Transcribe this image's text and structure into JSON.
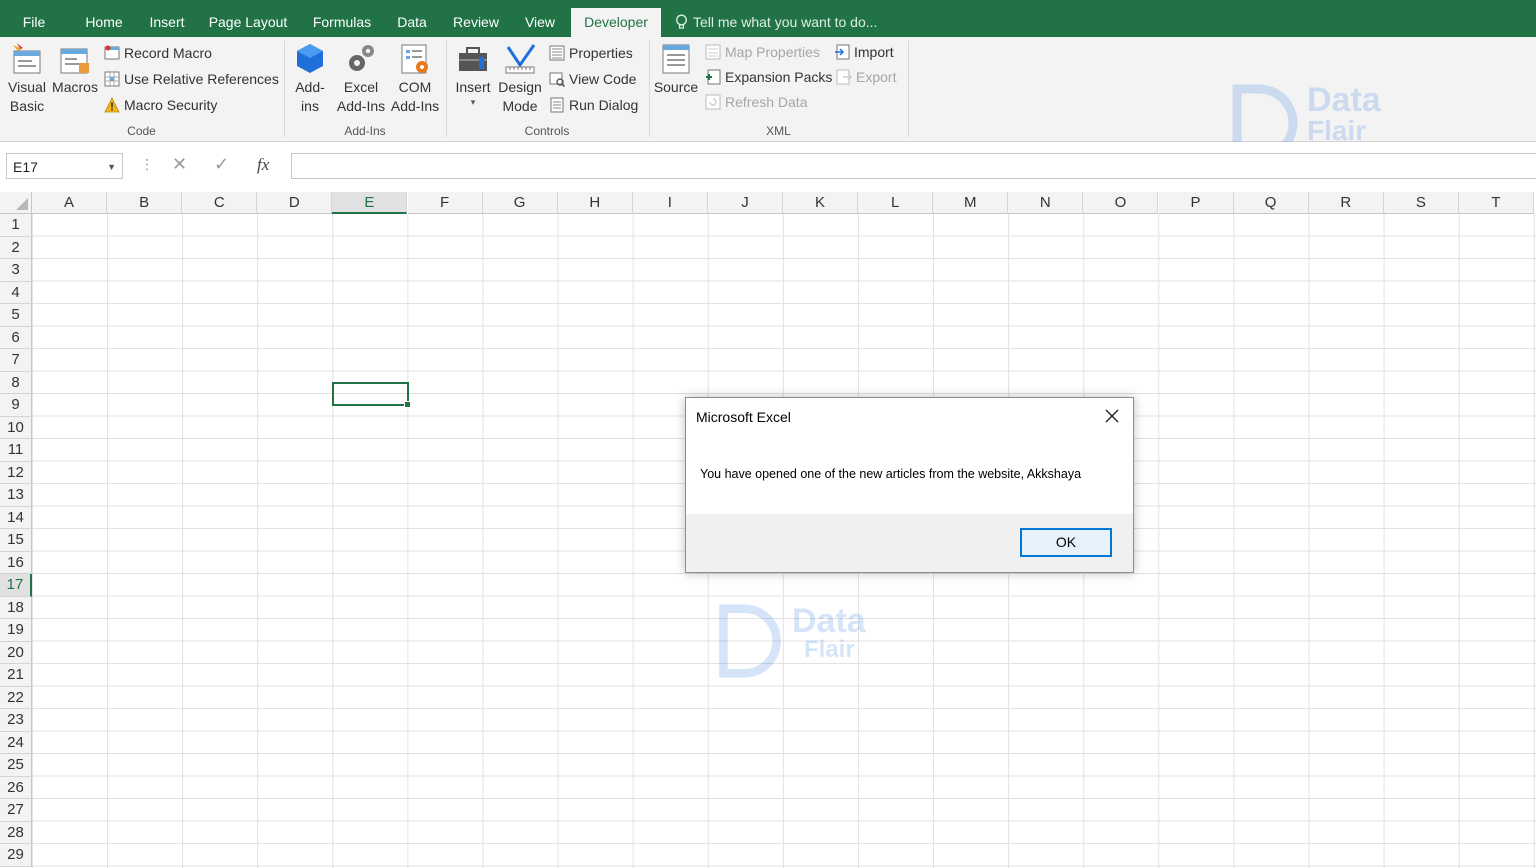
{
  "tabs": [
    "File",
    "Home",
    "Insert",
    "Page Layout",
    "Formulas",
    "Data",
    "Review",
    "View",
    "Developer"
  ],
  "active_tab": "Developer",
  "tell_me": "Tell me what you want to do...",
  "ribbon": {
    "code": {
      "label": "Code",
      "visual_basic": [
        "Visual",
        "Basic"
      ],
      "macros": "Macros",
      "record_macro": "Record Macro",
      "use_relative": "Use Relative References",
      "macro_security": "Macro Security"
    },
    "addins": {
      "label": "Add-Ins",
      "addins": [
        "Add-",
        "ins"
      ],
      "excel_addins": [
        "Excel",
        "Add-Ins"
      ],
      "com_addins": [
        "COM",
        "Add-Ins"
      ]
    },
    "controls": {
      "label": "Controls",
      "insert": "Insert",
      "design_mode": [
        "Design",
        "Mode"
      ],
      "properties": "Properties",
      "view_code": "View Code",
      "run_dialog": "Run Dialog"
    },
    "xml": {
      "label": "XML",
      "source": "Source",
      "map_properties": "Map Properties",
      "expansion_packs": "Expansion Packs",
      "refresh_data": "Refresh Data",
      "import": "Import",
      "export": "Export"
    }
  },
  "formula_bar": {
    "name_box": "E17",
    "fx": "fx",
    "value": ""
  },
  "columns": [
    "A",
    "B",
    "C",
    "D",
    "E",
    "F",
    "G",
    "H",
    "I",
    "J",
    "K",
    "L",
    "M",
    "N",
    "O",
    "P",
    "Q",
    "R",
    "S",
    "T"
  ],
  "rows": [
    "1",
    "2",
    "3",
    "4",
    "5",
    "6",
    "7",
    "8",
    "9",
    "10",
    "11",
    "12",
    "13",
    "14",
    "15",
    "16",
    "17",
    "18",
    "19",
    "20",
    "21",
    "22",
    "23",
    "24",
    "25",
    "26",
    "27",
    "28",
    "29"
  ],
  "selected_column": "E",
  "selected_row": "17",
  "watermark": {
    "line1": "Data",
    "line2": "Flair"
  },
  "dialog": {
    "title": "Microsoft Excel",
    "message": "You have opened one of the new articles from the website, Akkshaya",
    "ok_label": "OK"
  },
  "colors": {
    "excel_green": "#217346",
    "ribbon_bg": "#f3f3f3",
    "ok_border": "#0078d7"
  }
}
